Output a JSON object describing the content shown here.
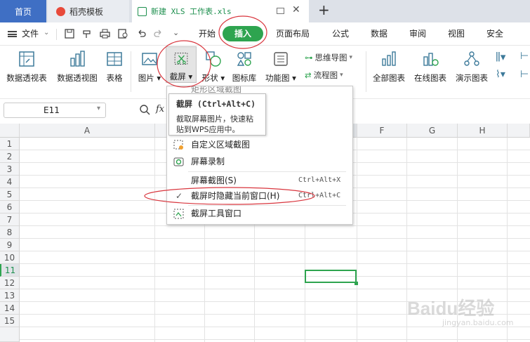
{
  "tabs": {
    "home": "首页",
    "templates": "稻壳模板",
    "document": "新建 XLS 工作表.xls",
    "new_tab": "+"
  },
  "menu": {
    "file": "文件",
    "items": [
      "开始",
      "插入",
      "页面布局",
      "公式",
      "数据",
      "审阅",
      "视图",
      "安全"
    ]
  },
  "ribbon": {
    "pivot_table": "数据透视表",
    "pivot_chart": "数据透视图",
    "table": "表格",
    "picture": "图片",
    "screenshot": "截屏",
    "shapes": "形状",
    "icon_library": "图标库",
    "function_chart": "功能图",
    "mind_map": "思维导图",
    "flowchart": "流程图",
    "all_charts": "全部图表",
    "online_charts": "在线图表",
    "demo_charts": "演示图表"
  },
  "formula_bar": {
    "cell_ref": "E11",
    "fx": "fx"
  },
  "grid": {
    "columns": [
      "A",
      "B",
      "C",
      "D",
      "E",
      "F",
      "G",
      "H"
    ],
    "rows": [
      "1",
      "2",
      "3",
      "4",
      "5",
      "6",
      "7",
      "8",
      "9",
      "10",
      "11",
      "12",
      "13",
      "14",
      "15"
    ],
    "selected_cell": "E11"
  },
  "tooltip": {
    "title": "截屏 (Ctrl+Alt+C)",
    "body_line1": "截取屏幕图片，快速粘",
    "body_line2": "贴到WPS应用中。"
  },
  "dropdown": {
    "partial_item": "矩形区域截图",
    "items": [
      {
        "label": "自定义区域截图",
        "shortcut": ""
      },
      {
        "label": "屏幕录制",
        "shortcut": ""
      },
      {
        "label": "屏幕截图(S)",
        "shortcut": "Ctrl+Alt+X"
      },
      {
        "label": "截屏时隐藏当前窗口(H)",
        "shortcut": "Ctrl+Alt+C",
        "checked": true
      },
      {
        "label": "截屏工具窗口",
        "shortcut": ""
      }
    ]
  },
  "watermark": {
    "brand": "Baidu经验",
    "url": "jingyan.baidu.com"
  },
  "colors": {
    "accent_green": "#2ea44f",
    "home_tab": "#3f6fc4",
    "annotation": "#d9363e"
  }
}
